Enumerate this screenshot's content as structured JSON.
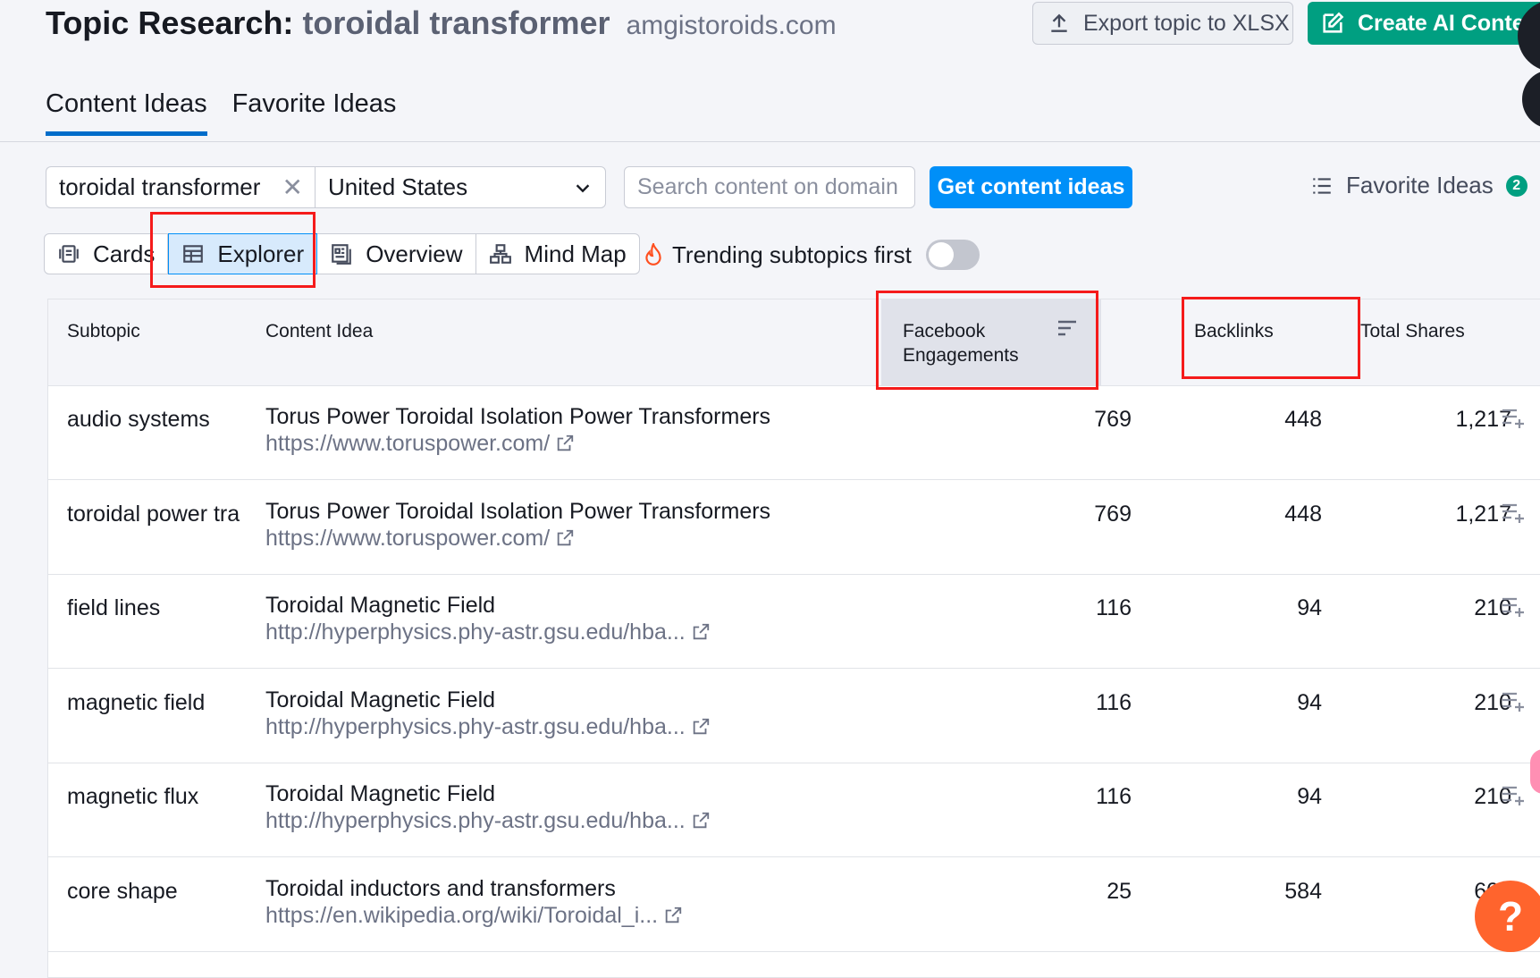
{
  "header": {
    "title_prefix": "Topic Research:",
    "topic": "toroidal transformer",
    "domain": "amgistoroids.com",
    "export_label": "Export topic to XLSX",
    "ai_label": "Create AI Content"
  },
  "tabs": [
    {
      "label": "Content Ideas",
      "active": true
    },
    {
      "label": "Favorite Ideas",
      "active": false
    }
  ],
  "filters": {
    "keyword": "toroidal transformer",
    "country": "United States",
    "domain_search_placeholder": "Search content on domain",
    "get_ideas_label": "Get content ideas",
    "favorite_ideas_label": "Favorite Ideas",
    "favorite_count": "2"
  },
  "views": [
    {
      "label": "Cards",
      "icon": "cards-icon"
    },
    {
      "label": "Explorer",
      "icon": "table-icon",
      "active": true
    },
    {
      "label": "Overview",
      "icon": "overview-icon"
    },
    {
      "label": "Mind Map",
      "icon": "mind-map-icon"
    }
  ],
  "trending_label": "Trending subtopics first",
  "table": {
    "columns": {
      "subtopic": "Subtopic",
      "content_idea": "Content Idea",
      "facebook_1": "Facebook",
      "facebook_2": "Engagements",
      "backlinks": "Backlinks",
      "total_shares": "Total Shares"
    },
    "rows": [
      {
        "subtopic": "audio systems",
        "title": "Torus Power Toroidal Isolation Power Transformers",
        "url": "https://www.toruspower.com/",
        "facebook": "769",
        "backlinks": "448",
        "shares": "1,217"
      },
      {
        "subtopic": "toroidal power tra",
        "title": "Torus Power Toroidal Isolation Power Transformers",
        "url": "https://www.toruspower.com/",
        "facebook": "769",
        "backlinks": "448",
        "shares": "1,217"
      },
      {
        "subtopic": "field lines",
        "title": "Toroidal Magnetic Field",
        "url": "http://hyperphysics.phy-astr.gsu.edu/hba...",
        "facebook": "116",
        "backlinks": "94",
        "shares": "210"
      },
      {
        "subtopic": "magnetic field",
        "title": "Toroidal Magnetic Field",
        "url": "http://hyperphysics.phy-astr.gsu.edu/hba...",
        "facebook": "116",
        "backlinks": "94",
        "shares": "210"
      },
      {
        "subtopic": "magnetic flux",
        "title": "Toroidal Magnetic Field",
        "url": "http://hyperphysics.phy-astr.gsu.edu/hba...",
        "facebook": "116",
        "backlinks": "94",
        "shares": "210"
      },
      {
        "subtopic": "core shape",
        "title": "Toroidal inductors and transformers",
        "url": "https://en.wikipedia.org/wiki/Toroidal_i...",
        "facebook": "25",
        "backlinks": "584",
        "shares": "609"
      }
    ]
  },
  "help_label": "?",
  "colors": {
    "accent": "#008ff8",
    "brand_green": "#009f81",
    "annotation_red": "#f51b1b",
    "help_orange": "#ff642d"
  }
}
